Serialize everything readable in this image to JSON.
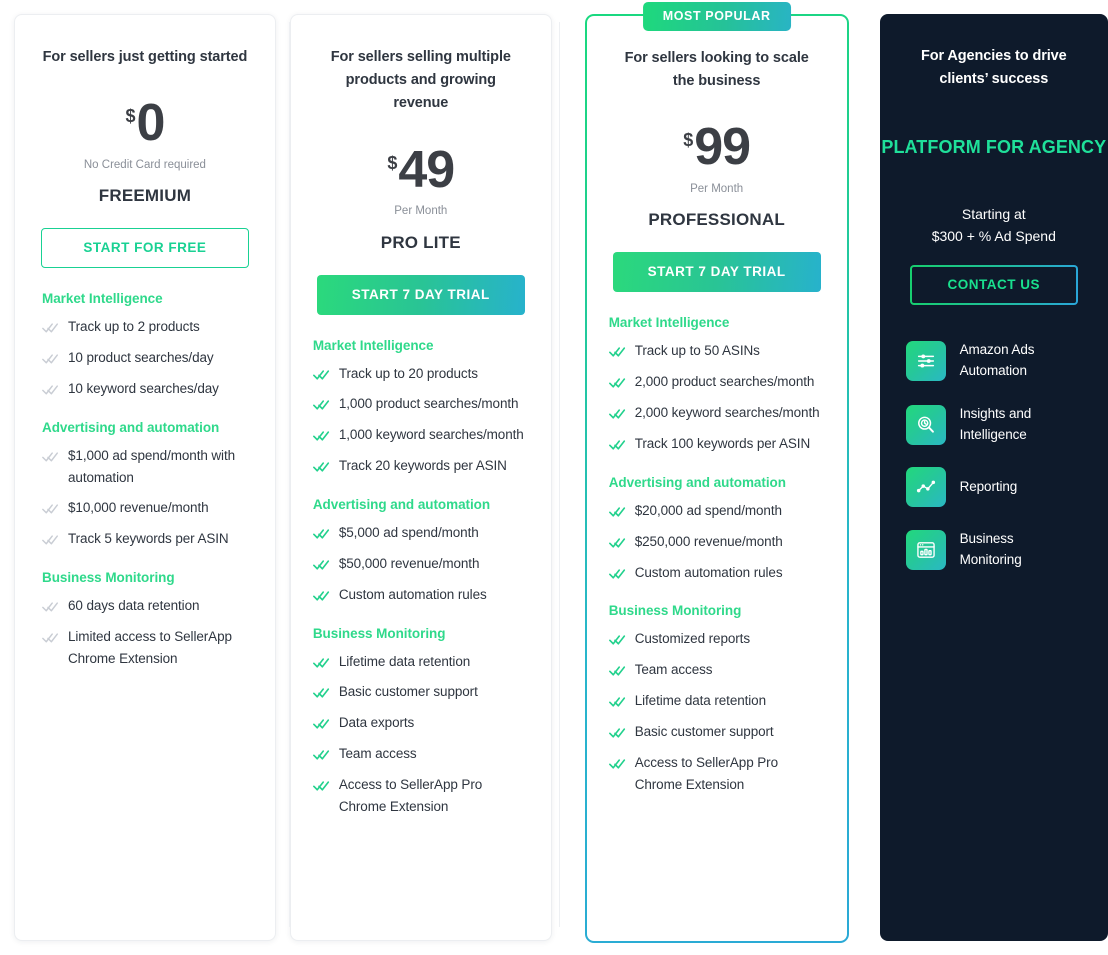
{
  "colors": {
    "accent_green": "#2fd98b",
    "accent_teal": "#27b2cc",
    "dark_card_bg": "#0e1a2b",
    "agency_heading": "#1fe09a",
    "text_dark": "#2f3640",
    "muted": "#8a8f98"
  },
  "plans": [
    {
      "id": "freemium",
      "tagline": "For sellers just getting started",
      "currency": "$",
      "amount": "0",
      "price_sub": "No Credit Card required",
      "plan_name": "FREEMIUM",
      "cta_label": "START FOR FREE",
      "cta_style": "outline",
      "tick_style": "muted",
      "groups": [
        {
          "title": "Market Intelligence",
          "items": [
            "Track up to 2 products",
            "10 product searches/day",
            "10 keyword searches/day"
          ]
        },
        {
          "title": "Advertising and automation",
          "items": [
            "$1,000 ad spend/month with automation",
            "$10,000 revenue/month",
            "Track 5 keywords per ASIN"
          ]
        },
        {
          "title": "Business Monitoring",
          "items": [
            "60 days data retention",
            "Limited access to SellerApp Chrome Extension"
          ]
        }
      ]
    },
    {
      "id": "pro-lite",
      "tagline": "For sellers selling multiple products and growing revenue",
      "currency": "$",
      "amount": "49",
      "price_sub": "Per Month",
      "plan_name": "PRO LITE",
      "cta_label": "START 7 DAY TRIAL",
      "cta_style": "gradient",
      "tick_style": "green",
      "groups": [
        {
          "title": "Market Intelligence",
          "items": [
            "Track up to 20 products",
            "1,000 product searches/month",
            "1,000 keyword searches/month",
            "Track 20 keywords per ASIN"
          ]
        },
        {
          "title": "Advertising and automation",
          "items": [
            "$5,000 ad spend/month",
            "$50,000 revenue/month",
            "Custom automation rules"
          ]
        },
        {
          "title": "Business Monitoring",
          "items": [
            "Lifetime data retention",
            "Basic customer support",
            "Data exports",
            "Team access",
            "Access to SellerApp Pro Chrome Extension"
          ]
        }
      ]
    },
    {
      "id": "professional",
      "badge": "MOST POPULAR",
      "tagline": "For sellers looking to scale the business",
      "currency": "$",
      "amount": "99",
      "price_sub": "Per Month",
      "plan_name": "PROFESSIONAL",
      "cta_label": "START 7 DAY TRIAL",
      "cta_style": "gradient",
      "tick_style": "green",
      "groups": [
        {
          "title": "Market Intelligence",
          "items": [
            "Track up to 50 ASINs",
            "2,000 product searches/month",
            "2,000 keyword searches/month",
            "Track 100 keywords per ASIN"
          ]
        },
        {
          "title": "Advertising and automation",
          "items": [
            "$20,000 ad spend/month",
            "$250,000 revenue/month",
            "Custom automation rules"
          ]
        },
        {
          "title": "Business Monitoring",
          "items": [
            "Customized reports",
            "Team access",
            "Lifetime data retention",
            "Basic customer support",
            "Access to SellerApp Pro Chrome Extension"
          ]
        }
      ]
    }
  ],
  "agency": {
    "tagline": "For Agencies to drive clients’ success",
    "platform_label": "PLATFORM FOR AGENCY",
    "starting_line1": "Starting at",
    "starting_line2": "$300 + % Ad Spend",
    "cta_label": "CONTACT US",
    "features": [
      {
        "icon": "sliders-icon",
        "label": "Amazon Ads Automation"
      },
      {
        "icon": "magnifier-clock-icon",
        "label": "Insights and Intelligence"
      },
      {
        "icon": "line-chart-icon",
        "label": "Reporting"
      },
      {
        "icon": "dashboard-icon",
        "label": "Business Monitoring"
      }
    ]
  }
}
